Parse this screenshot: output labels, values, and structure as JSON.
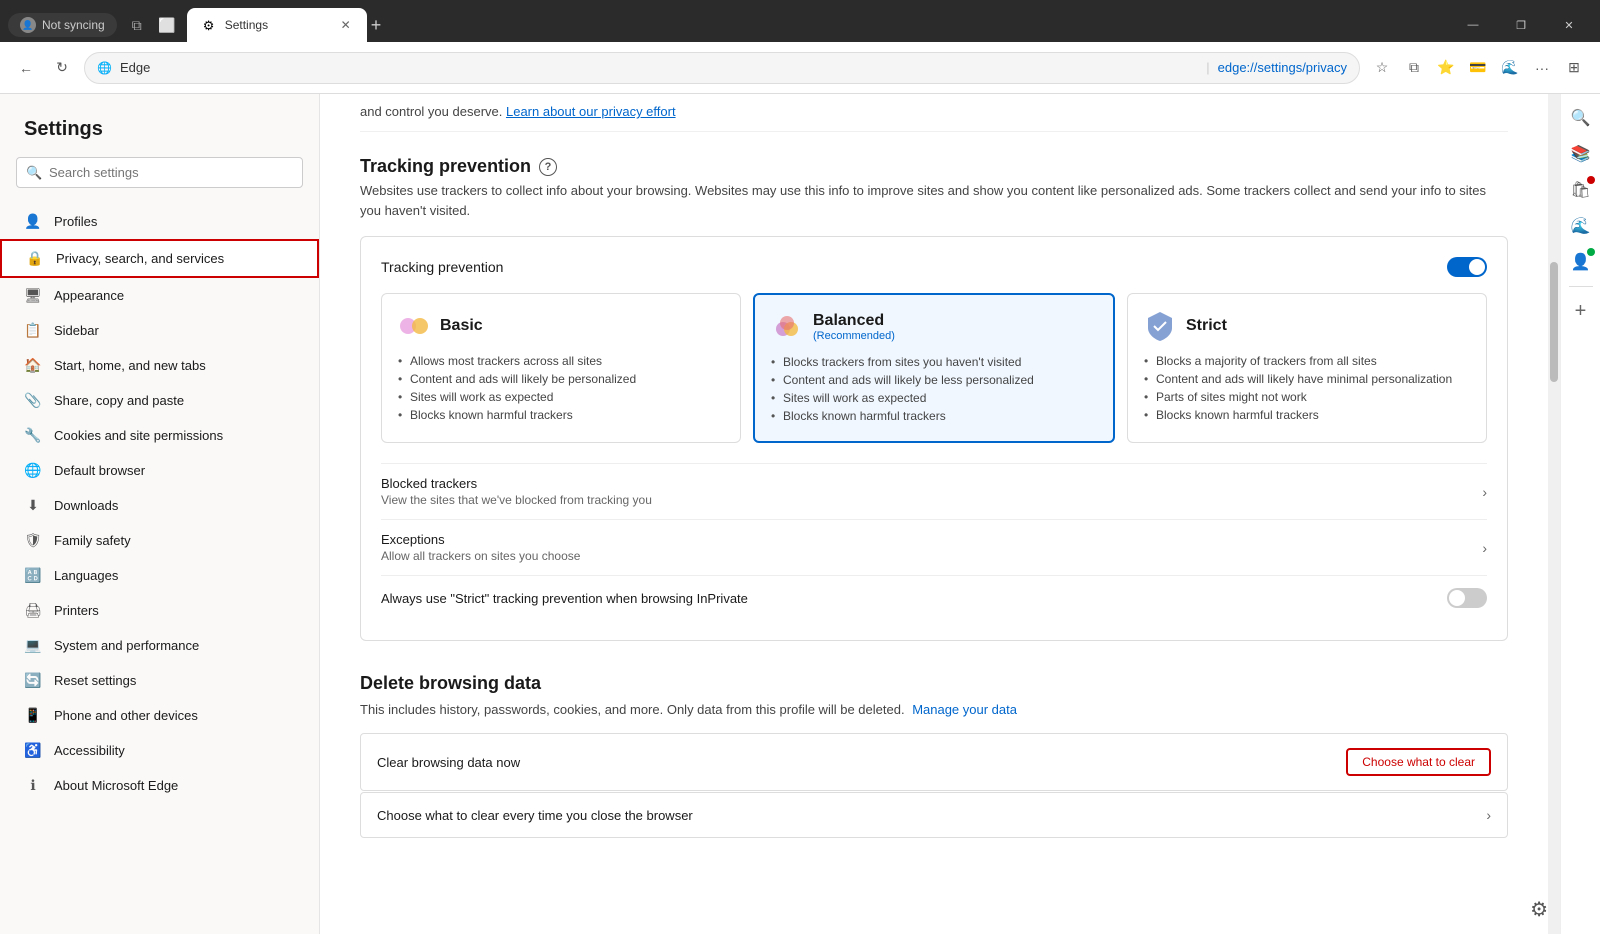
{
  "browser": {
    "profile_text": "Not syncing",
    "tab_title": "Settings",
    "address_text": "Edge",
    "address_url": "edge://settings/privacy",
    "window_controls": [
      "—",
      "❐",
      "✕"
    ]
  },
  "sidebar": {
    "title": "Settings",
    "search_placeholder": "Search settings",
    "nav_items": [
      {
        "id": "profiles",
        "label": "Profiles",
        "icon": "👤"
      },
      {
        "id": "privacy",
        "label": "Privacy, search, and services",
        "icon": "🔒",
        "active": true,
        "highlighted": true
      },
      {
        "id": "appearance",
        "label": "Appearance",
        "icon": "🖥"
      },
      {
        "id": "sidebar",
        "label": "Sidebar",
        "icon": "📋"
      },
      {
        "id": "start-home",
        "label": "Start, home, and new tabs",
        "icon": "🏠"
      },
      {
        "id": "share-copy",
        "label": "Share, copy and paste",
        "icon": "📎"
      },
      {
        "id": "cookies",
        "label": "Cookies and site permissions",
        "icon": "🔧"
      },
      {
        "id": "default-browser",
        "label": "Default browser",
        "icon": "🌐"
      },
      {
        "id": "downloads",
        "label": "Downloads",
        "icon": "⬇"
      },
      {
        "id": "family-safety",
        "label": "Family safety",
        "icon": "🛡"
      },
      {
        "id": "languages",
        "label": "Languages",
        "icon": "🔠"
      },
      {
        "id": "printers",
        "label": "Printers",
        "icon": "🖨"
      },
      {
        "id": "system",
        "label": "System and performance",
        "icon": "💻"
      },
      {
        "id": "reset",
        "label": "Reset settings",
        "icon": "🔄"
      },
      {
        "id": "phone",
        "label": "Phone and other devices",
        "icon": "📱"
      },
      {
        "id": "accessibility",
        "label": "Accessibility",
        "icon": "♿"
      },
      {
        "id": "about",
        "label": "About Microsoft Edge",
        "icon": "ℹ"
      }
    ]
  },
  "content": {
    "top_link": "Learn about our privacy effort",
    "tracking_prevention": {
      "title": "Tracking prevention",
      "description": "Websites use trackers to collect info about your browsing. Websites may use this info to improve sites and show you content like personalized ads. Some trackers collect and send your info to sites you haven't visited.",
      "toggle_on": true,
      "box_title": "Tracking prevention",
      "cards": [
        {
          "id": "basic",
          "title": "Basic",
          "subtitle": "",
          "selected": false,
          "points": [
            "Allows most trackers across all sites",
            "Content and ads will likely be personalized",
            "Sites will work as expected",
            "Blocks known harmful trackers"
          ]
        },
        {
          "id": "balanced",
          "title": "Balanced",
          "subtitle": "(Recommended)",
          "selected": true,
          "points": [
            "Blocks trackers from sites you haven't visited",
            "Content and ads will likely be less personalized",
            "Sites will work as expected",
            "Blocks known harmful trackers"
          ]
        },
        {
          "id": "strict",
          "title": "Strict",
          "subtitle": "",
          "selected": false,
          "points": [
            "Blocks a majority of trackers from all sites",
            "Content and ads will likely have minimal personalization",
            "Parts of sites might not work",
            "Blocks known harmful trackers"
          ]
        }
      ],
      "rows": [
        {
          "title": "Blocked trackers",
          "desc": "View the sites that we've blocked from tracking you"
        },
        {
          "title": "Exceptions",
          "desc": "Allow all trackers on sites you choose"
        }
      ],
      "strict_inprivate_label": "Always use \"Strict\" tracking prevention when browsing InPrivate",
      "strict_inprivate_on": false
    },
    "delete_browsing_data": {
      "title": "Delete browsing data",
      "desc": "This includes history, passwords, cookies, and more. Only data from this profile will be deleted.",
      "manage_link": "Manage your data",
      "clear_now_label": "Clear browsing data now",
      "clear_btn_label": "Choose what to clear",
      "clear_every_time_label": "Choose what to clear every time you close the browser"
    }
  },
  "right_sidebar": {
    "buttons": [
      {
        "id": "search",
        "icon": "🔍"
      },
      {
        "id": "collections",
        "icon": "📚"
      },
      {
        "id": "shopping",
        "icon": "🛍"
      },
      {
        "id": "edge-bar",
        "icon": "🌊"
      },
      {
        "id": "notifications",
        "icon": "👤",
        "badge": "red"
      },
      {
        "id": "outlook",
        "icon": "✉",
        "badge": "green"
      }
    ]
  }
}
